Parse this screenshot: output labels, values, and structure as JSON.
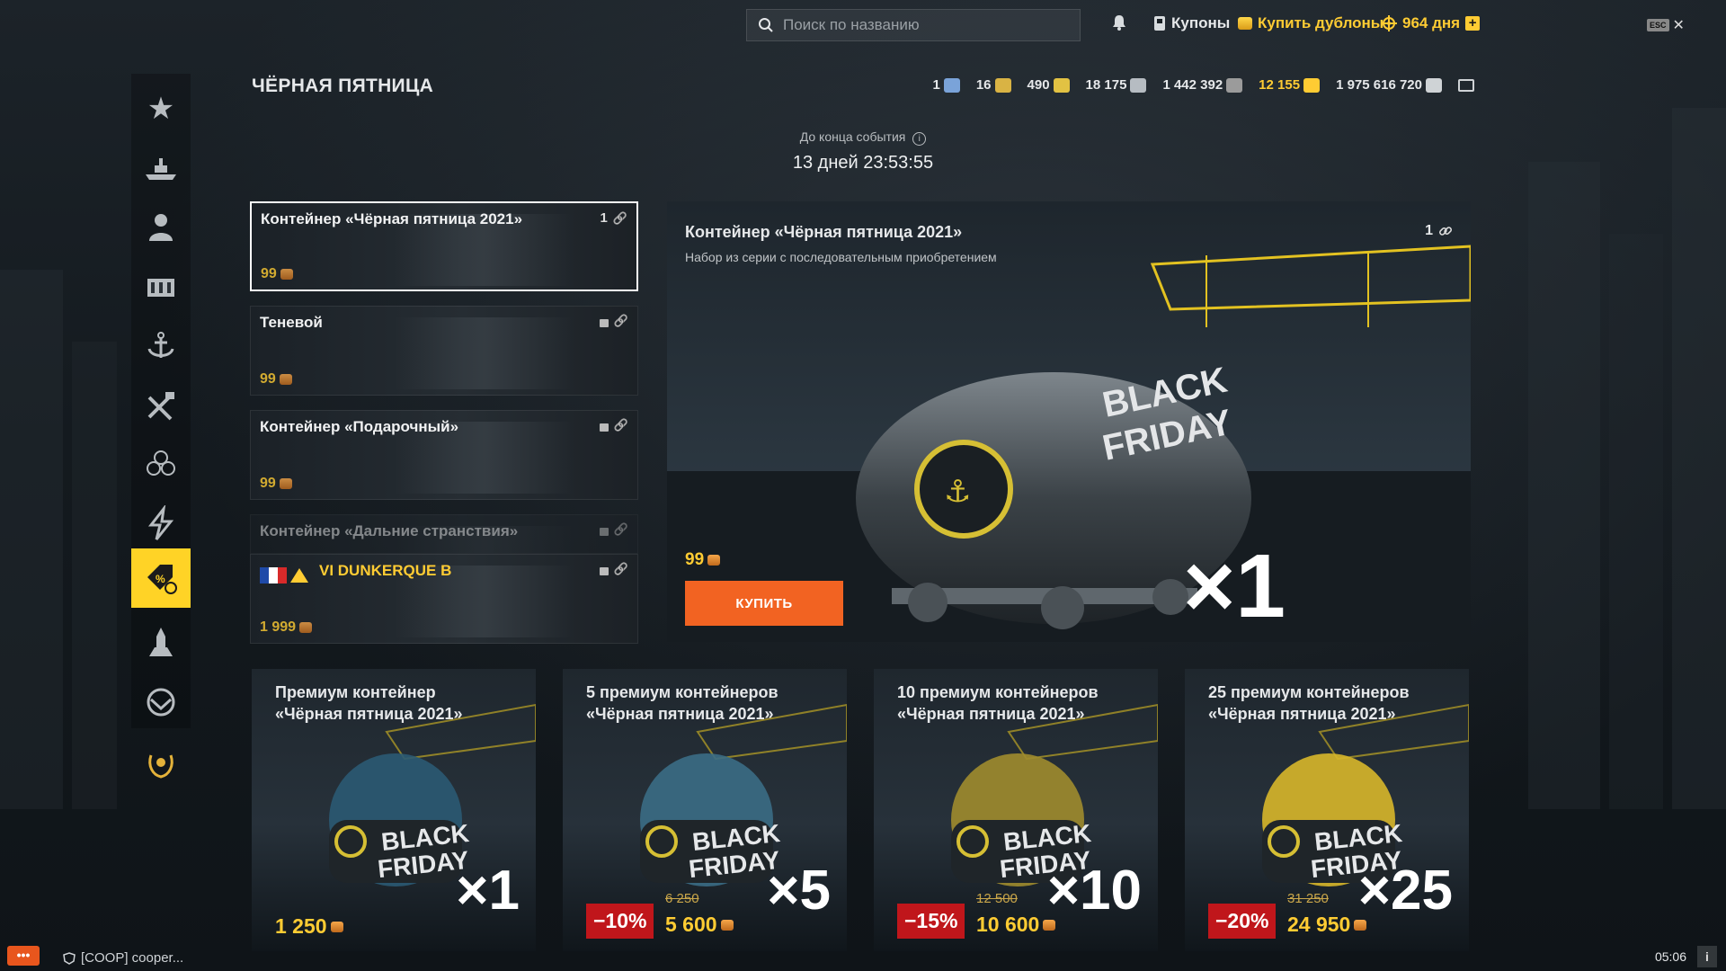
{
  "topbar": {
    "search_placeholder": "Поиск по названию",
    "coupons_label": "Купоны",
    "buy_doubloons_label": "Купить дублоны",
    "premium_days": "964 дня",
    "esc_label": "ESC"
  },
  "header": {
    "title": "ЧЁРНАЯ ПЯТНИЦА",
    "resources": [
      {
        "value": "1",
        "icon": "camo-icon",
        "color": "#7aa3d9"
      },
      {
        "value": "16",
        "icon": "signal-flag-icon",
        "color": "#d9b344"
      },
      {
        "value": "490",
        "icon": "coal-icon",
        "color": "#e2c243"
      },
      {
        "value": "18 175",
        "icon": "steel-icon",
        "color": "#b6bcc2"
      },
      {
        "value": "1 442 392",
        "icon": "free-xp-icon",
        "color": "#9b9b9b"
      },
      {
        "value": "12 155",
        "icon": "doubloon-icon",
        "color": "#ffcc33",
        "gold": true
      },
      {
        "value": "1 975 616 720",
        "icon": "credits-icon",
        "color": "#cfd3d6"
      }
    ]
  },
  "timer": {
    "label": "До конца события",
    "value": "13 дней 23:53:55"
  },
  "list": [
    {
      "title": "Контейнер «Чёрная пятница 2021»",
      "price": "99",
      "count": "1",
      "locked": false,
      "selected": true
    },
    {
      "title": "Теневой",
      "price": "99",
      "count": "",
      "locked": true,
      "selected": false
    },
    {
      "title": "Контейнер «Подарочный»",
      "price": "99",
      "count": "",
      "locked": true,
      "selected": false
    },
    {
      "title": "Контейнер «Дальние странствия»",
      "price": "",
      "count": "",
      "locked": true,
      "selected": false
    },
    {
      "title": "VI DUNKERQUE B",
      "price": "1 999",
      "count": "",
      "locked": true,
      "selected": false
    }
  ],
  "feature": {
    "title": "Контейнер «Чёрная пятница 2021»",
    "subtitle": "Набор из серии с последовательным приобретением",
    "count": "1",
    "price": "99",
    "buy_label": "КУПИТЬ",
    "multiplier": "×1",
    "art_text_1": "BLACK",
    "art_text_2": "FRIDAY"
  },
  "bundles": [
    {
      "title": "Премиум контейнер\n«Чёрная пятница 2021»",
      "multiplier": "×1",
      "price": "1 250",
      "discount": "",
      "old_price": ""
    },
    {
      "title": "5 премиум контейнеров\n«Чёрная пятница 2021»",
      "multiplier": "×5",
      "price": "5 600",
      "discount": "−10%",
      "old_price": "6 250"
    },
    {
      "title": "10 премиум контейнеров\n«Чёрная пятница 2021»",
      "multiplier": "×10",
      "price": "10 600",
      "discount": "−15%",
      "old_price": "12 500"
    },
    {
      "title": "25 премиум контейнеров\n«Чёрная пятница 2021»",
      "multiplier": "×25",
      "price": "24 950",
      "discount": "−20%",
      "old_price": "31 250"
    }
  ],
  "footer": {
    "chat_button": "•••",
    "chat_text": "[COOP] cooper...",
    "clock": "05:06",
    "info_label": "i"
  },
  "colors": {
    "accent_yellow": "#ffd326",
    "buy_orange": "#f26322",
    "discount_red": "#c0161b",
    "gold_text": "#ffcc33"
  }
}
